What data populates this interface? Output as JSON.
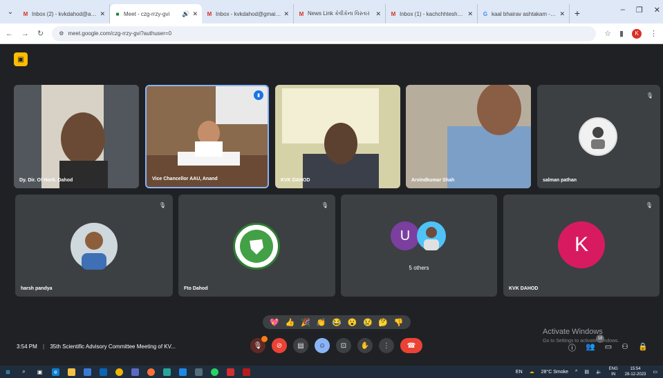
{
  "browser": {
    "tabs": [
      {
        "icon": "gmail-icon",
        "title": "Inbox (2) - kvkdahod@aau.in",
        "active": false
      },
      {
        "icon": "meet-icon",
        "title": "Meet - czg-rrzy-gvi",
        "active": true
      },
      {
        "icon": "gmail-icon",
        "title": "Inbox - kvkdahod@gmail.com",
        "active": false
      },
      {
        "icon": "gmail-icon",
        "title": "News Link કેવીકેના વિસ્તાર",
        "active": false
      },
      {
        "icon": "gmail-icon",
        "title": "Inbox (1) - kachchhtesh@aau.in",
        "active": false
      },
      {
        "icon": "google-icon",
        "title": "kaal bhairav ashtakam - Goo",
        "active": false
      }
    ],
    "url": "meet.google.com/czg-rrzy-gvi?authuser=0",
    "profile_initial": "K"
  },
  "meeting": {
    "participants_row1": [
      {
        "name": "Dy. Dir. Of Horti. Dahod",
        "type": "video"
      },
      {
        "name": "Vice Chancellor AAU, Anand",
        "type": "video",
        "speaking": true
      },
      {
        "name": "KVK DAHOD",
        "type": "video"
      },
      {
        "name": "Arvindkumar Shah",
        "type": "video"
      },
      {
        "name": "salman pathan",
        "type": "avatar-photo",
        "muted": true
      }
    ],
    "participants_row2": [
      {
        "name": "harsh pandya",
        "type": "avatar-photo",
        "muted": true
      },
      {
        "name": "Fto Dahod",
        "type": "avatar-logo",
        "muted": true
      },
      {
        "name": "",
        "type": "others",
        "others_initial": "U",
        "others_count": "5 others"
      },
      {
        "name": "KVK DAHOD",
        "type": "avatar-letter",
        "initial": "K",
        "muted": true,
        "color": "#d81b60"
      }
    ],
    "time": "3:54 PM",
    "title": "35th Scientific Advisory Committee Meeting of KV...",
    "reactions": [
      "💖",
      "👍",
      "🎉",
      "👏",
      "😂",
      "😮",
      "😢",
      "🤔",
      "👎"
    ],
    "participant_count": "18"
  },
  "watermark": {
    "line1": "Activate Windows",
    "line2": "Go to Settings to activate Windows."
  },
  "taskbar": {
    "weather": "28°C  Smoke",
    "lang": "ENG",
    "region": "IN",
    "time": "15:54",
    "date": "28-12-2023",
    "keyboard": "EN"
  },
  "colors": {
    "meet_bg": "#202124",
    "tile_bg": "#3c4043",
    "end_call": "#ea4335",
    "presenting": "#fbbc04",
    "speaking_border": "#8ab4f8"
  }
}
